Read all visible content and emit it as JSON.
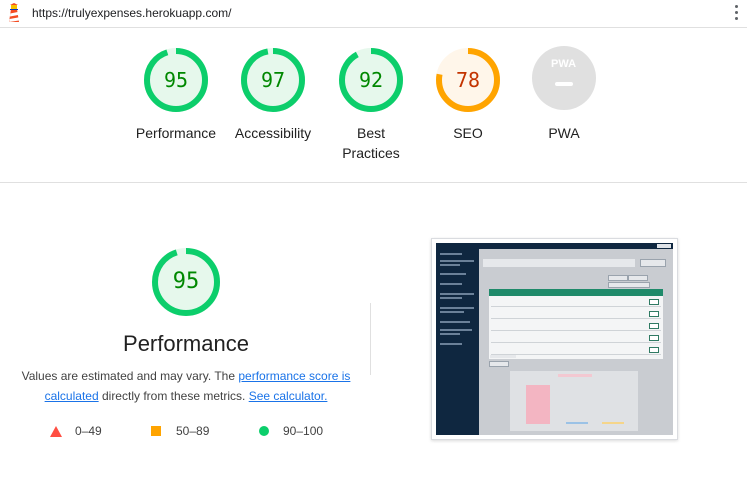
{
  "url": "https://trulyexpenses.herokuapp.com/",
  "colors": {
    "pass": "#0cce6b",
    "pass_fill": "#e6f8ec",
    "pass_text": "#008800",
    "average": "#ffa400",
    "average_fill": "#fff6ea",
    "average_text": "#c33300",
    "fail": "#ff4e42",
    "na": "#e0e0e0",
    "link": "#1a73e8"
  },
  "categories": [
    {
      "id": "performance",
      "score": 95,
      "label": "Performance",
      "status": "pass"
    },
    {
      "id": "accessibility",
      "score": 97,
      "label": "Accessibility",
      "status": "pass"
    },
    {
      "id": "best-practices",
      "score": 92,
      "label": "Best Practices",
      "status": "pass"
    },
    {
      "id": "seo",
      "score": 78,
      "label": "SEO",
      "status": "average"
    },
    {
      "id": "pwa",
      "score": null,
      "label": "PWA",
      "status": "na",
      "badge": "PWA"
    }
  ],
  "performance_detail": {
    "score": 95,
    "title": "Performance",
    "desc_prefix": "Values are estimated and may vary. The ",
    "desc_link1": "performance score is calculated",
    "desc_middle": " directly from these metrics. ",
    "desc_link2": "See calculator."
  },
  "legend": [
    {
      "shape": "triangle",
      "range": "0–49"
    },
    {
      "shape": "square",
      "range": "50–89"
    },
    {
      "shape": "circle",
      "range": "90–100"
    }
  ],
  "screenshot": {
    "icon": "page-screenshot-thumbnail"
  }
}
